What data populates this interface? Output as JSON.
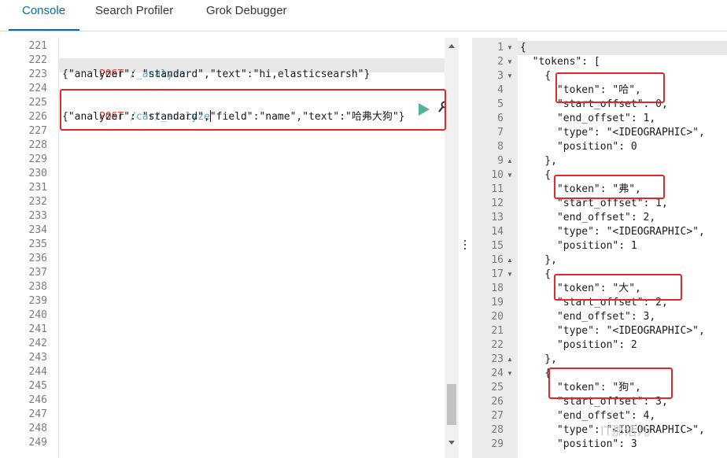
{
  "tabs": [
    {
      "label": "Console",
      "active": true
    },
    {
      "label": "Search Profiler",
      "active": false
    },
    {
      "label": "Grok Debugger",
      "active": false
    }
  ],
  "editor": {
    "line_numbers": [
      "221",
      "222",
      "223",
      "224",
      "225",
      "226",
      "227",
      "228",
      "229",
      "230",
      "231",
      "232",
      "233",
      "234",
      "235",
      "236",
      "237",
      "238",
      "239",
      "240",
      "241",
      "242",
      "243",
      "244",
      "245",
      "246",
      "247",
      "248",
      "249"
    ],
    "request1": {
      "method": "POST",
      "url": " /_analyze",
      "body": "{\"analyzer\": \"standard\",\"text\":\"hi,elasticsearsh\"}"
    },
    "request2": {
      "method": "POST",
      "url": " /car/_analyze",
      "body": "{\"analyzer\": \"standard\",\"field\":\"name\",\"text\":\"哈弗大狗\"}"
    }
  },
  "output": {
    "line_numbers": [
      "1",
      "2",
      "3",
      "4",
      "5",
      "6",
      "7",
      "8",
      "9",
      "10",
      "11",
      "12",
      "13",
      "14",
      "15",
      "16",
      "17",
      "18",
      "19",
      "20",
      "21",
      "22",
      "23",
      "24",
      "25",
      "26",
      "27",
      "28",
      "29"
    ],
    "fold_markers": {
      "1": "▼",
      "2": "▼",
      "3": "▼",
      "9": "▲",
      "10": "▼",
      "16": "▲",
      "17": "▼",
      "23": "▲",
      "24": "▼"
    },
    "lines": [
      "{",
      "  \"tokens\": [",
      "    {",
      "      \"token\": \"哈\",",
      "      \"start_offset\": 0,",
      "      \"end_offset\": 1,",
      "      \"type\": \"<IDEOGRAPHIC>\",",
      "      \"position\": 0",
      "    },",
      "    {",
      "      \"token\": \"弗\",",
      "      \"start_offset\": 1,",
      "      \"end_offset\": 2,",
      "      \"type\": \"<IDEOGRAPHIC>\",",
      "      \"position\": 1",
      "    },",
      "    {",
      "      \"token\": \"大\",",
      "      \"start_offset\": 2,",
      "      \"end_offset\": 3,",
      "      \"type\": \"<IDEOGRAPHIC>\",",
      "      \"position\": 2",
      "    },",
      "    {",
      "      \"token\": \"狗\",",
      "      \"start_offset\": 3,",
      "      \"end_offset\": 4,",
      "      \"type\": \"<IDEOGRAPHIC>\",",
      "      \"position\": 3"
    ]
  },
  "watermark": "IT那活儿",
  "colors": {
    "accent": "#006bb4",
    "method": "#e2443f",
    "url": "#56a6c9",
    "highlight": "#e8262a",
    "play": "#54b399"
  }
}
